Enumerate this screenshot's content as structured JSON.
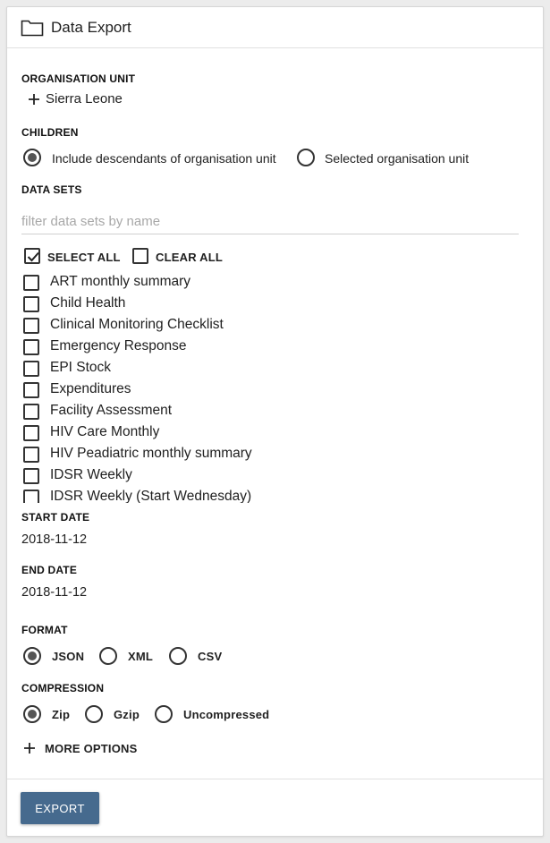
{
  "header": {
    "title": "Data Export",
    "icon": "folder-icon"
  },
  "org_unit": {
    "label": "ORGANISATION UNIT",
    "root": "Sierra Leone"
  },
  "children": {
    "label": "CHILDREN",
    "options": [
      "Include descendants of organisation unit",
      "Selected organisation unit"
    ],
    "selected": "Include descendants of organisation unit"
  },
  "data_sets": {
    "label": "DATA SETS",
    "filter_placeholder": "filter data sets by name",
    "select_all": "SELECT ALL",
    "clear_all": "CLEAR ALL",
    "select_all_checked": true,
    "items": [
      "ART monthly summary",
      "Child Health",
      "Clinical Monitoring Checklist",
      "Emergency Response",
      "EPI Stock",
      "Expenditures",
      "Facility Assessment",
      "HIV Care Monthly",
      "HIV Peadiatric monthly summary",
      "IDSR Weekly",
      "IDSR Weekly (Start Wednesday)"
    ]
  },
  "start_date": {
    "label": "START DATE",
    "value": "2018-11-12"
  },
  "end_date": {
    "label": "END DATE",
    "value": "2018-11-12"
  },
  "format": {
    "label": "FORMAT",
    "options": [
      "JSON",
      "XML",
      "CSV"
    ],
    "selected": "JSON"
  },
  "compression": {
    "label": "COMPRESSION",
    "options": [
      "Zip",
      "Gzip",
      "Uncompressed"
    ],
    "selected": "Zip"
  },
  "more_options": "MORE OPTIONS",
  "export_button": "EXPORT",
  "colors": {
    "primary": "#466a8e",
    "radio_checked": "#555555"
  }
}
